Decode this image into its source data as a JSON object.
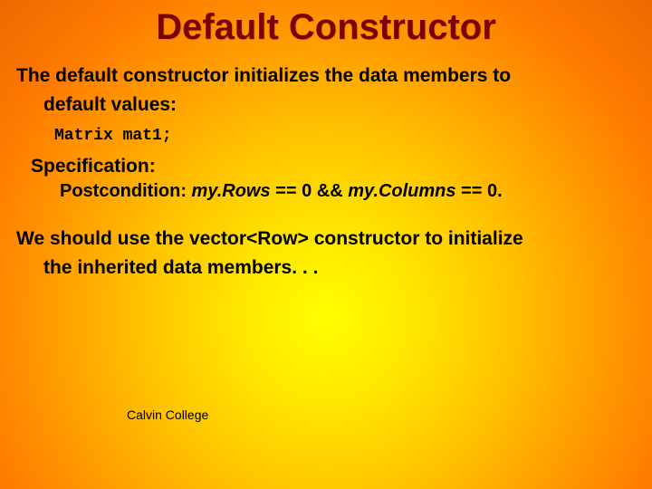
{
  "title": "Default Constructor",
  "intro_l1": "The default constructor initializes the data members to",
  "intro_l2": "default values:",
  "code": "Matrix mat1;",
  "spec_label": "Specification:",
  "postcond_prefix": "Postcondition: ",
  "postcond_r": "my.Rows",
  "postcond_mid1": " == 0 && ",
  "postcond_c": "my.Columns",
  "postcond_mid2": " == 0.",
  "advice_l1": "We should use the vector<Row> constructor to initialize",
  "advice_l2": "the inherited data members. . .",
  "footer": "Calvin College"
}
